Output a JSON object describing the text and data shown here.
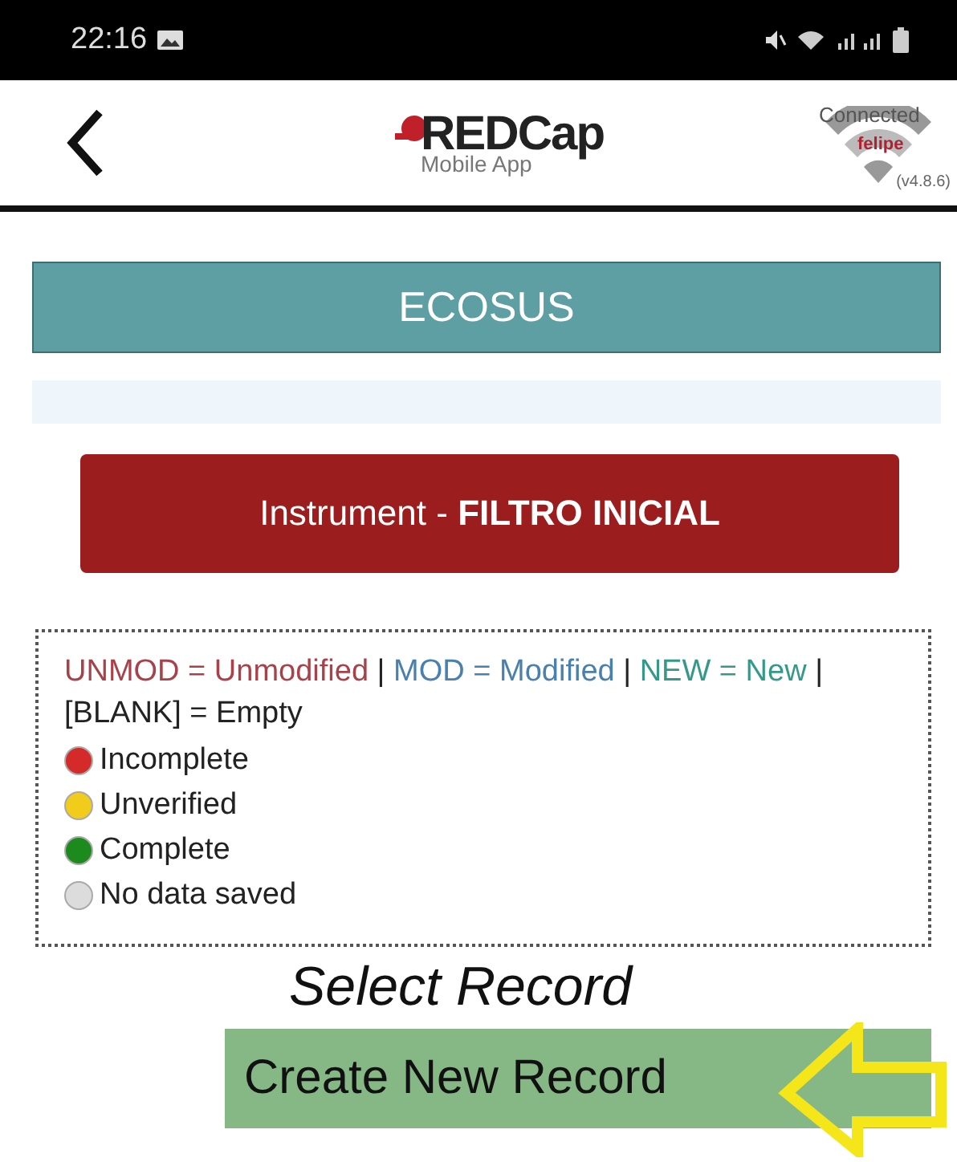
{
  "status_bar": {
    "time": "22:16"
  },
  "header": {
    "logo_text": "REDCap",
    "logo_subtitle": "Mobile App",
    "connection": {
      "status": "Connected",
      "user": "felipe",
      "version": "(v4.8.6)"
    }
  },
  "project": {
    "title": "ECOSUS"
  },
  "instrument_button": {
    "label": "Instrument - ",
    "name": "FILTRO INICIAL"
  },
  "legend": {
    "segments": [
      {
        "text": "UNMOD = Unmodified",
        "kind": "unmod"
      },
      {
        "text": " | ",
        "kind": "plain"
      },
      {
        "text": "MOD = Modified",
        "kind": "mod"
      },
      {
        "text": " | ",
        "kind": "plain"
      },
      {
        "text": "NEW = New",
        "kind": "new"
      },
      {
        "text": " | [BLANK] = Empty",
        "kind": "plain"
      }
    ],
    "statuses": [
      {
        "label": "Incomplete",
        "color": "#d42a2a"
      },
      {
        "label": "Unverified",
        "color": "#f2cc1a"
      },
      {
        "label": "Complete",
        "color": "#1d8a1d"
      },
      {
        "label": "No data saved",
        "color": "#dcdcdc"
      }
    ]
  },
  "select_heading": "Select Record",
  "create_button": {
    "label": "Create New Record"
  }
}
